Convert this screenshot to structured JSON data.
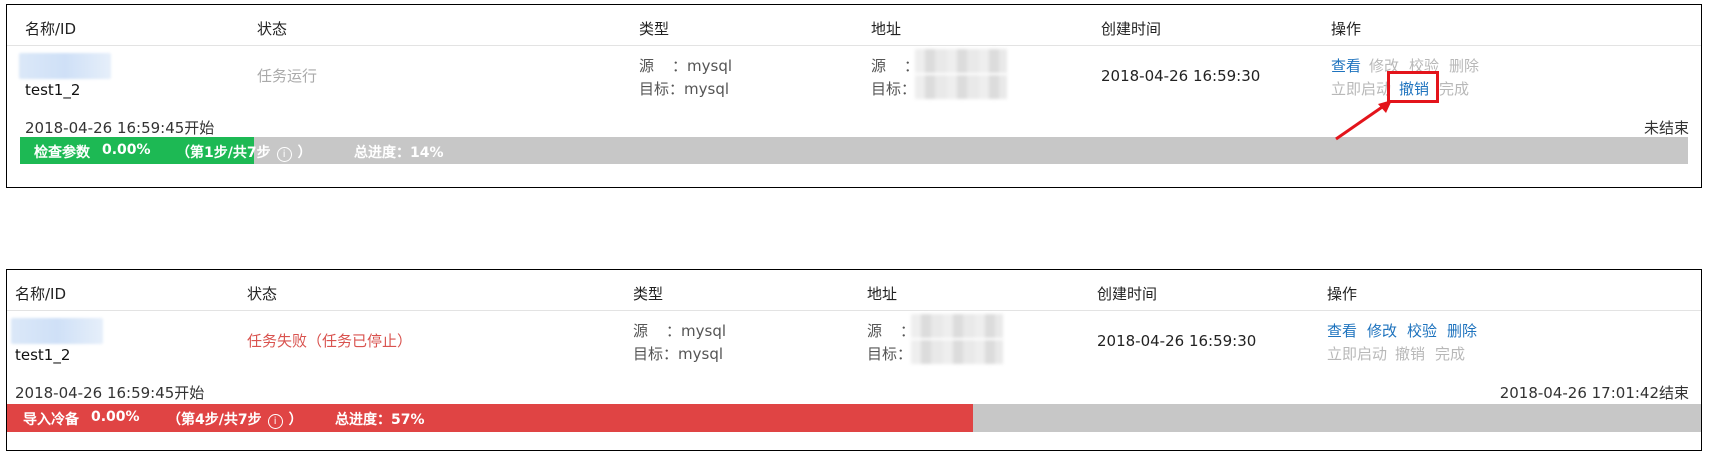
{
  "columns": {
    "name": "名称/ID",
    "status": "状态",
    "type": "类型",
    "address": "地址",
    "created": "创建时间",
    "actions": "操作"
  },
  "tasks": [
    {
      "name": "test1_2",
      "status": "任务运行",
      "source_label": "源",
      "source_type": "：mysql",
      "target_label": "目标",
      "target_type": "：mysql",
      "addr_source_label": "源",
      "addr_source_sep": "：",
      "addr_target_label": "目标",
      "addr_target_sep": "：",
      "created_time": "2018-04-26 16:59:30",
      "actions_row1": [
        "查看",
        "修改",
        "校验",
        "删除"
      ],
      "actions_row2": [
        "立即启动",
        "撤销",
        "完成"
      ],
      "start_time": "2018-04-26 16:59:45开始",
      "end_status": "未结束",
      "progress": {
        "step_name": "检查参数",
        "percent_text": "0.00%",
        "step_text": "（第1步/共7步",
        "info_icon": "i",
        "close_paren": "）",
        "total_text": "总进度：14%",
        "fill_fraction": 0.14,
        "color": "#1db954"
      }
    },
    {
      "name": "test1_2",
      "status": "任务失败（任务已停止）",
      "source_label": "源",
      "source_type": "：mysql",
      "target_label": "目标",
      "target_type": "：mysql",
      "addr_source_label": "源",
      "addr_source_sep": "：",
      "addr_target_label": "目标",
      "addr_target_sep": "：",
      "created_time": "2018-04-26 16:59:30",
      "actions_row1": [
        "查看",
        "修改",
        "校验",
        "删除"
      ],
      "actions_row2": [
        "立即启动",
        "撤销",
        "完成"
      ],
      "start_time": "2018-04-26 16:59:45开始",
      "end_status": "2018-04-26 17:01:42结束",
      "progress": {
        "step_name": "导入冷备",
        "percent_text": "0.00%",
        "step_text": "（第4步/共7步",
        "info_icon": "i",
        "close_paren": "）",
        "total_text": "总进度：57%",
        "fill_fraction": 0.57,
        "color": "#e04444"
      }
    }
  ],
  "colors": {
    "link": "#1e73be",
    "disabled": "#b8b8b8",
    "highlight": "#e3141b",
    "failed_text": "#d9534f",
    "bar_bg": "#c7c7c7"
  }
}
